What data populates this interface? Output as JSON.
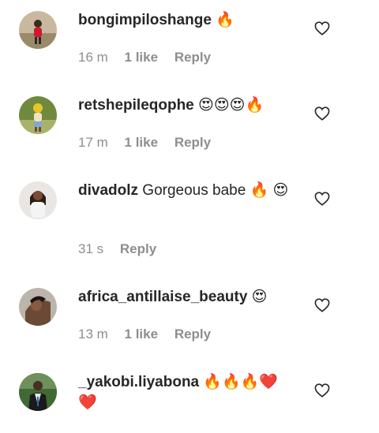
{
  "comments": [
    {
      "username": "bongimpiloshange",
      "text": "🔥",
      "time": "16 m",
      "likes": "1 like",
      "reply": "Reply"
    },
    {
      "username": "retshepileqophe",
      "text": "😍😍😍🔥",
      "time": "17 m",
      "likes": "1 like",
      "reply": "Reply"
    },
    {
      "username": "divadolz",
      "text": "Gorgeous babe 🔥 😍",
      "time": "31 s",
      "likes": "",
      "reply": "Reply"
    },
    {
      "username": "africa_antillaise_beauty",
      "text": "😍",
      "time": "13 m",
      "likes": "1 like",
      "reply": "Reply"
    },
    {
      "username": "_yakobi.liyabona",
      "text": "🔥🔥🔥❤️ ❤️",
      "time": "",
      "likes": "",
      "reply": ""
    }
  ],
  "icons": {
    "like": "heart-outline-icon",
    "avatar": "user-avatar"
  },
  "colors": {
    "text": "#262626",
    "meta": "#8e8e8e"
  }
}
